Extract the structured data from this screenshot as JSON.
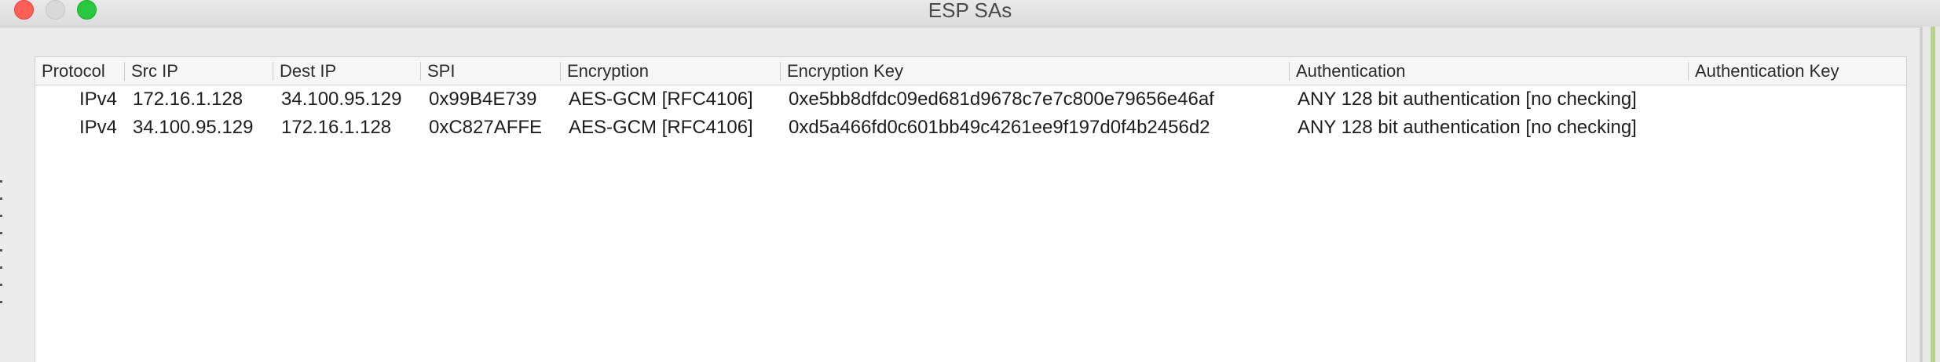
{
  "window": {
    "title": "ESP SAs"
  },
  "table": {
    "columns": [
      "Protocol",
      "Src IP",
      "Dest IP",
      "SPI",
      "Encryption",
      "Encryption Key",
      "Authentication",
      "Authentication Key"
    ],
    "rows": [
      {
        "protocol": "IPv4",
        "src_ip": "172.16.1.128",
        "dest_ip": "34.100.95.129",
        "spi": "0x99B4E739",
        "encryption": "AES-GCM [RFC4106]",
        "encryption_key": "0xe5bb8dfdc09ed681d9678c7e7c800e79656e46af",
        "authentication": "ANY 128 bit authentication [no checking]",
        "authentication_key": ""
      },
      {
        "protocol": "IPv4",
        "src_ip": "34.100.95.129",
        "dest_ip": "172.16.1.128",
        "spi": "0xC827AFFE",
        "encryption": "AES-GCM [RFC4106]",
        "encryption_key": "0xd5a466fd0c601bb49c4261ee9f197d0f4b2456d2",
        "authentication": "ANY 128 bit authentication [no checking]",
        "authentication_key": ""
      }
    ]
  }
}
